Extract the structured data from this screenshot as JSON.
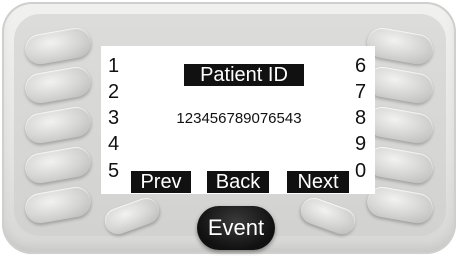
{
  "screen": {
    "title": "Patient ID",
    "patient_id_value": "123456789076543"
  },
  "left_key_labels": [
    "1",
    "2",
    "3",
    "4",
    "5"
  ],
  "right_key_labels": [
    "6",
    "7",
    "8",
    "9",
    "0"
  ],
  "softkeys": {
    "prev": "Prev",
    "back": "Back",
    "next": "Next"
  },
  "event_button": "Event"
}
